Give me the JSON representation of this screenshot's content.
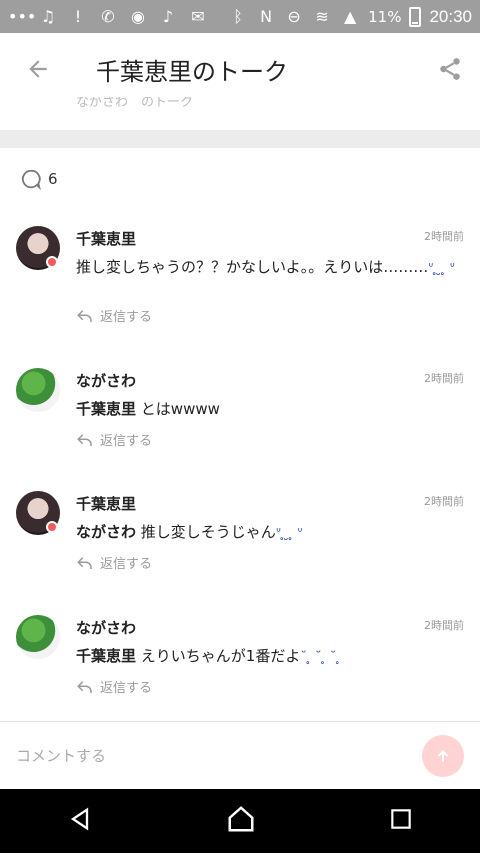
{
  "status_bar": {
    "battery_percent": "11%",
    "time": "20:30"
  },
  "header": {
    "title": "千葉恵里のトーク"
  },
  "partial_text": "ながさわ　のトーク",
  "comment_count": "6",
  "comments": [
    {
      "name": "千葉恵里",
      "time": "2時間前",
      "mention": "",
      "text": "推し変しちゃうの？？かなしいよ。。えりいは………",
      "emoji": "ᐡ ̥ ̮ ̥ ᐡ",
      "reply_label": "返信する"
    },
    {
      "name": "ながさわ",
      "time": "2時間前",
      "mention": "千葉恵里",
      "text": "とはwwww",
      "emoji": "",
      "reply_label": "返信する"
    },
    {
      "name": "千葉恵里",
      "time": "2時間前",
      "mention": "ながさわ",
      "text": "推し変しそうじゃん",
      "emoji": "ᐡ ̥ ̮ ̥ ᐡ",
      "reply_label": "返信する"
    },
    {
      "name": "ながさわ",
      "time": "2時間前",
      "mention": "千葉恵里",
      "text": "えりいちゃんが1番だよ",
      "emoji": "˘ ̥ ˘ ̥ ˘ ̥",
      "reply_label": "返信する"
    }
  ],
  "input": {
    "placeholder": "コメントする"
  },
  "colors": {
    "accent": "#f25b5b",
    "send_button_disabled": "#ffd3d3",
    "status_bar": "#9e9e9e"
  },
  "icons": {
    "back": "arrow-left-icon",
    "share": "share-icon",
    "comment": "comment-bubble-icon",
    "reply": "reply-arrow-icon",
    "send": "send-icon",
    "nav_back": "triangle-back-icon",
    "nav_home": "home-icon",
    "nav_recent": "square-recent-icon"
  }
}
